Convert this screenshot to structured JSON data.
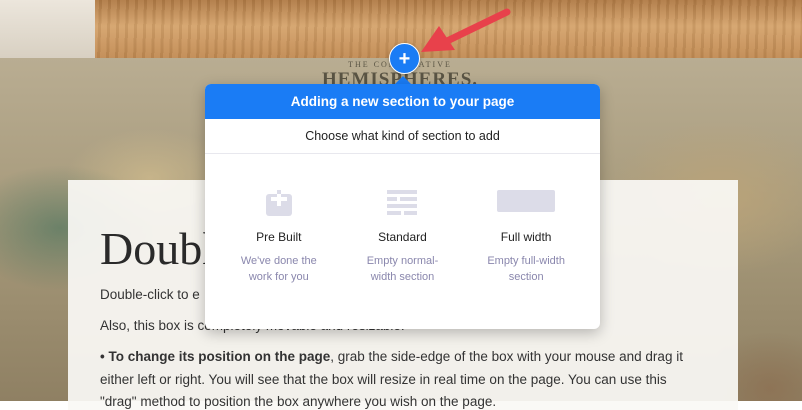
{
  "background": {
    "map_title_small": "THE COMPARATIVE",
    "map_title_big": "HEMISPHERES."
  },
  "add_section_button": {
    "label": "+"
  },
  "popup": {
    "header": "Adding a new section to your page",
    "subheader": "Choose what kind of section to add",
    "options": [
      {
        "icon": "prebuilt-icon",
        "title": "Pre Built",
        "desc_line1": "We've done the",
        "desc_line2": "work for you"
      },
      {
        "icon": "standard-icon",
        "title": "Standard",
        "desc_line1": "Empty normal-",
        "desc_line2": "width section"
      },
      {
        "icon": "fullwidth-icon",
        "title": "Full width",
        "desc_line1": "Empty full-width",
        "desc_line2": "section"
      }
    ]
  },
  "content": {
    "heading": "Doubl",
    "line1": "Double-click to e",
    "line2": "Also, this box is completely movable and resizable.",
    "line3_bold": "• To change its position on the page",
    "line3_rest": ", grab the side-edge of the box with your mouse and drag it",
    "line4": "either left or right. You will see that the box will resize in real time on the page. You can use this",
    "line5": "\"drag\" method to position the box anywhere you wish on the page."
  },
  "colors": {
    "accent": "#1a7cf5",
    "arrow": "#e8414b",
    "icon_fill": "#dcdce8",
    "desc_text": "#8a87ad"
  }
}
